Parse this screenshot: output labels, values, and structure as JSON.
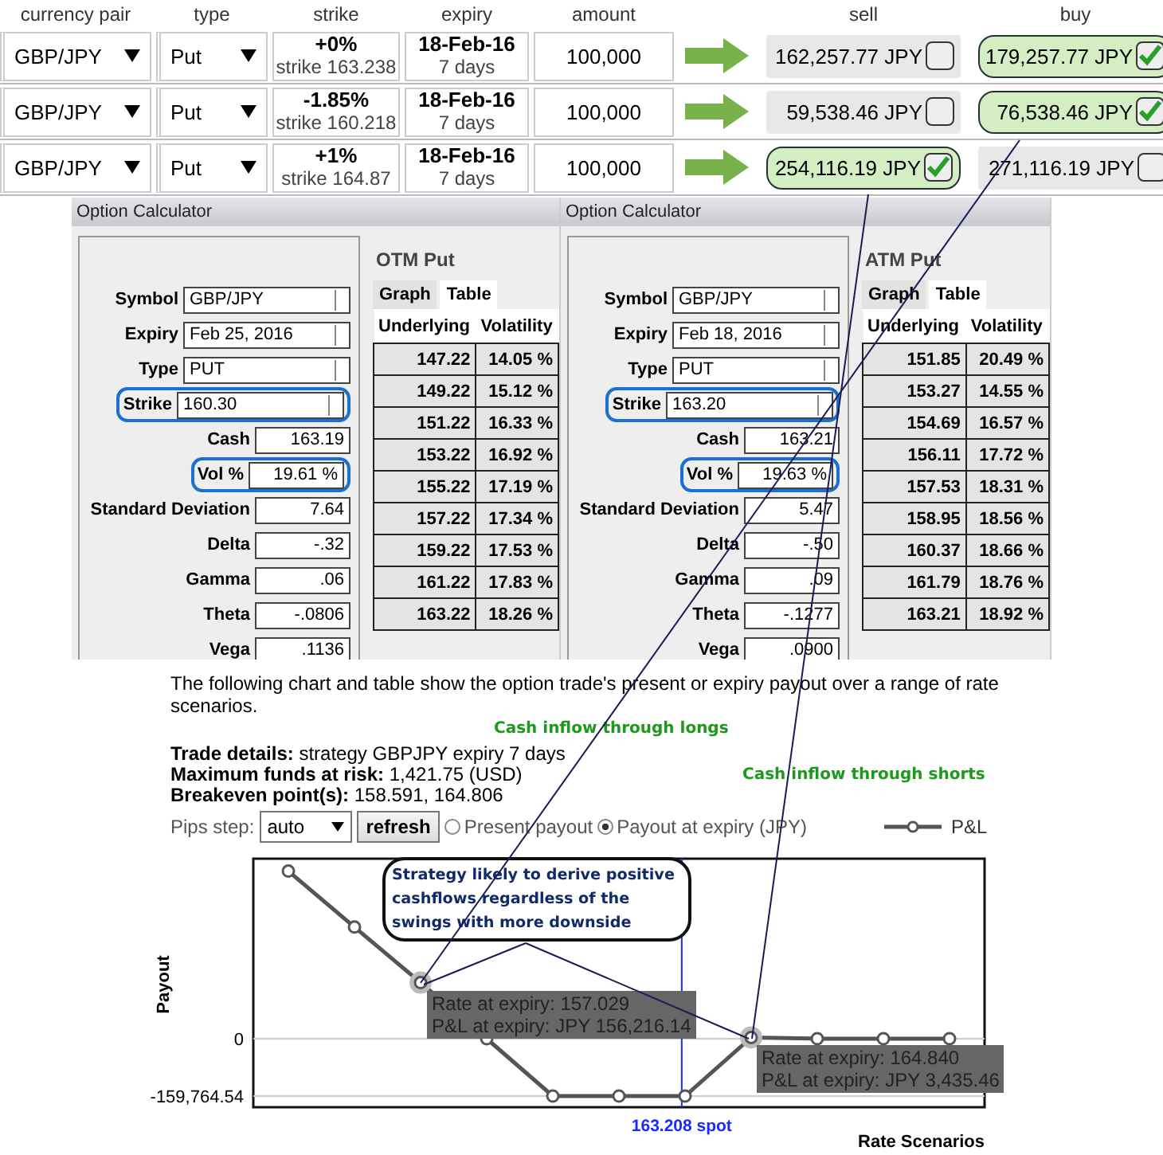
{
  "trades": {
    "columns": [
      "currency pair",
      "type",
      "strike",
      "expiry",
      "amount",
      "sell",
      "buy"
    ],
    "rows": [
      {
        "pair": "GBP/JPY",
        "type": "Put",
        "strike_pct": "+0%",
        "strike": "strike 163.238",
        "expiry_date": "18-Feb-16",
        "expiry_days": "7 days",
        "amount": "100,000",
        "sell": {
          "price": "162,257.77 JPY",
          "checked": false
        },
        "buy": {
          "price": "179,257.77 JPY",
          "checked": true
        }
      },
      {
        "pair": "GBP/JPY",
        "type": "Put",
        "strike_pct": "-1.85%",
        "strike": "strike 160.218",
        "expiry_date": "18-Feb-16",
        "expiry_days": "7 days",
        "amount": "100,000",
        "sell": {
          "price": "59,538.46 JPY",
          "checked": false
        },
        "buy": {
          "price": "76,538.46 JPY",
          "checked": true
        }
      },
      {
        "pair": "GBP/JPY",
        "type": "Put",
        "strike_pct": "+1%",
        "strike": "strike 164.87",
        "expiry_date": "18-Feb-16",
        "expiry_days": "7 days",
        "amount": "100,000",
        "sell": {
          "price": "254,116.19 JPY",
          "checked": true
        },
        "buy": {
          "price": "271,116.19 JPY",
          "checked": false
        }
      }
    ]
  },
  "calculators": [
    {
      "title": "Option Calculator",
      "fields": [
        {
          "label": "Symbol",
          "value": "GBP/JPY",
          "kind": "select",
          "highlighted": false
        },
        {
          "label": "Expiry",
          "value": "Feb 25, 2016",
          "kind": "select",
          "highlighted": false
        },
        {
          "label": "Type",
          "value": "PUT",
          "kind": "select",
          "highlighted": false
        },
        {
          "label": "Strike",
          "value": "160.30",
          "kind": "select",
          "highlighted": true
        },
        {
          "label": "Cash",
          "value": "163.19",
          "kind": "number",
          "highlighted": false
        },
        {
          "label": "Vol %",
          "value": "19.61 %",
          "kind": "number",
          "highlighted": true
        },
        {
          "label": "Standard Deviation",
          "value": "7.64",
          "kind": "number",
          "highlighted": false
        },
        {
          "label": "Delta",
          "value": "-.32",
          "kind": "number",
          "highlighted": false
        },
        {
          "label": "Gamma",
          "value": ".06",
          "kind": "number",
          "highlighted": false
        },
        {
          "label": "Theta",
          "value": "-.0806",
          "kind": "number",
          "highlighted": false
        },
        {
          "label": "Vega",
          "value": ".1136",
          "kind": "number",
          "highlighted": false
        }
      ],
      "heading": "OTM Put",
      "tabs": [
        {
          "label": "Graph",
          "selected": false
        },
        {
          "label": "Table",
          "selected": true
        }
      ],
      "columns": [
        "Underlying",
        "Volatility"
      ],
      "rows": [
        [
          "147.22",
          "14.05 %"
        ],
        [
          "149.22",
          "15.12 %"
        ],
        [
          "151.22",
          "16.33 %"
        ],
        [
          "153.22",
          "16.92 %"
        ],
        [
          "155.22",
          "17.19 %"
        ],
        [
          "157.22",
          "17.34 %"
        ],
        [
          "159.22",
          "17.53 %"
        ],
        [
          "161.22",
          "17.83 %"
        ],
        [
          "163.22",
          "18.26 %"
        ]
      ]
    },
    {
      "title": "Option Calculator",
      "fields": [
        {
          "label": "Symbol",
          "value": "GBP/JPY",
          "kind": "select",
          "highlighted": false
        },
        {
          "label": "Expiry",
          "value": "Feb 18, 2016",
          "kind": "select",
          "highlighted": false
        },
        {
          "label": "Type",
          "value": "PUT",
          "kind": "select",
          "highlighted": false
        },
        {
          "label": "Strike",
          "value": "163.20",
          "kind": "select",
          "highlighted": true
        },
        {
          "label": "Cash",
          "value": "163.21",
          "kind": "number",
          "highlighted": false
        },
        {
          "label": "Vol %",
          "value": "19.63 %",
          "kind": "number",
          "highlighted": true
        },
        {
          "label": "Standard Deviation",
          "value": "5.47",
          "kind": "number",
          "highlighted": false
        },
        {
          "label": "Delta",
          "value": "-.50",
          "kind": "number",
          "highlighted": false
        },
        {
          "label": "Gamma",
          "value": ".09",
          "kind": "number",
          "highlighted": false
        },
        {
          "label": "Theta",
          "value": "-.1277",
          "kind": "number",
          "highlighted": false
        },
        {
          "label": "Vega",
          "value": ".0900",
          "kind": "number",
          "highlighted": false
        }
      ],
      "heading": "ATM Put",
      "tabs": [
        {
          "label": "Graph",
          "selected": false
        },
        {
          "label": "Table",
          "selected": true
        }
      ],
      "columns": [
        "Underlying",
        "Volatility"
      ],
      "rows": [
        [
          "151.85",
          "20.49 %"
        ],
        [
          "153.27",
          "14.55 %"
        ],
        [
          "154.69",
          "16.57 %"
        ],
        [
          "156.11",
          "17.72 %"
        ],
        [
          "157.53",
          "18.31 %"
        ],
        [
          "158.95",
          "18.56 %"
        ],
        [
          "160.37",
          "18.66 %"
        ],
        [
          "161.79",
          "18.76 %"
        ],
        [
          "163.21",
          "18.92 %"
        ]
      ]
    }
  ],
  "report": {
    "intro": "The following chart and table show the option trade's present or expiry payout over a range of rate scenarios.",
    "notes": [
      "Cash inflow through longs",
      "Cash inflow through shorts"
    ],
    "details": [
      "**Trade details:** strategy GBPJPY expiry 7 days",
      "**Maximum funds at risk:** 1,421.75 (USD)",
      "**Breakeven point(s):** 158.591, 164.806"
    ],
    "pips_label": "Pips step:",
    "pips_value": "auto",
    "refresh": "refresh",
    "payout_options": [
      {
        "label": "Present payout",
        "selected": false
      },
      {
        "label": "Payout at expiry (JPY)",
        "selected": true
      }
    ],
    "callout": "Strategy likely to derive positive cashflows regardless of the swings with more downside",
    "spot_label": "163.208 spot",
    "tooltips": [
      {
        "lines": [
          "Rate at expiry: 157.029",
          "P&L at expiry: JPY 156,216.14"
        ]
      },
      {
        "lines": [
          "Rate at expiry: 164.840",
          "P&L at expiry: JPY 3,435.46"
        ]
      }
    ],
    "chart_data": {
      "type": "line",
      "xlabel": "Rate Scenarios",
      "ylabel": "Payout",
      "categories": [
        null,
        null,
        null,
        null,
        null,
        null,
        null,
        null,
        null,
        null,
        null
      ],
      "series": [
        {
          "name": "P&L",
          "color": "#555555",
          "marker": "circle",
          "values": [
            467000,
            311000,
            156216.14,
            0,
            -159764.54,
            -159764.54,
            -159764.54,
            3435.46,
            0,
            0,
            0
          ]
        }
      ],
      "ylim": [
        -190800,
        501500
      ],
      "yticks": [
        {
          "value": 0,
          "label": "0"
        },
        {
          "value": -159764.54,
          "label": "-159,764.54"
        }
      ]
    }
  }
}
